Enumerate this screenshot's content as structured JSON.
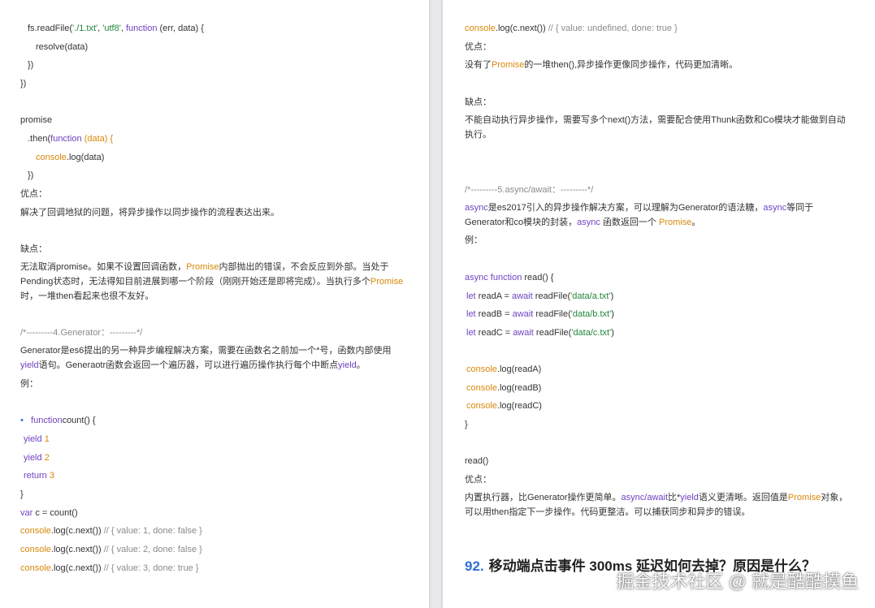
{
  "left": {
    "code_top": {
      "l1_call": "fs.readFile(",
      "l1_s1": "'./1.txt'",
      "l1_c1": ", ",
      "l1_s2": "'utf8'",
      "l1_c2": ", ",
      "l1_fn": "function",
      "l1_args": " (err, data) {",
      "l2": "resolve(data)",
      "l3": "})",
      "l4": "})"
    },
    "promise_code": {
      "l1": "promise",
      "l2_a": ".then(",
      "l2_fn": "function",
      "l2_b": " (data) {",
      "l3_obj": "console",
      "l3_b": ".log(data)",
      "l4": "})"
    },
    "pros_label": "优点：",
    "pros_text": "解决了回调地狱的问题，将异步操作以同步操作的流程表达出来。",
    "cons_label": "缺点：",
    "cons_text_1": "无法取消promise。如果不设置回调函数，",
    "cons_promise_1": "Promise",
    "cons_text_2": "内部抛出的错误，不会反应到外部。当处于Pending状态时，无法得知目前进展到哪一个阶段（刚刚开始还是即将完成）。当执行多个",
    "cons_promise_2": "Promise",
    "cons_text_3": "时，一堆then看起来也很不友好。",
    "gen_comment": "/*---------4.Generator：---------*/",
    "gen_desc_1": "Generator是es6提出的另一种异步编程解决方案，需要在函数名之前加一个*号，函数内部使用",
    "gen_yield_1": "yield",
    "gen_desc_2": "语句。Generaotr函数会返回一个遍历器，可以进行遍历操作执行每个中断点",
    "gen_yield_2": "yield",
    "gen_desc_3": "。",
    "example_label": "例：",
    "gen_code": {
      "bullet": "•",
      "l1_fn": "function",
      "l1_b": "count() {",
      "l2_kw": "yield",
      "l2_n": "1",
      "l3_kw": "yield",
      "l3_n": "2",
      "l4_kw": "return",
      "l4_n": "3",
      "l5": "}",
      "l6_kw": "var",
      "l6_b": " c = count()",
      "l7_obj": "console",
      "l7_b": ".log(c.next())",
      "l7_c": " // { value: 1, done: false }",
      "l8_obj": "console",
      "l8_b": ".log(c.next())",
      "l8_c": " // { value: 2, done: false }",
      "l9_obj": "console",
      "l9_b": ".log(c.next())",
      "l9_c": " // { value: 3, done: true }"
    }
  },
  "right": {
    "top_line": {
      "obj": "console",
      "b": ".log(c.next())",
      "c": " // { value: undefined, done: true }"
    },
    "pros_label": "优点：",
    "pros_text_1": "没有了",
    "pros_promise": "Promise",
    "pros_text_2": "的一堆then(),异步操作更像同步操作，代码更加清晰。",
    "cons_label": "缺点：",
    "cons_text": "不能自动执行异步操作，需要写多个next()方法，需要配合使用Thunk函数和Co模块才能做到自动执行。",
    "async_comment": "/*---------5.async/await：---------*/",
    "async_desc": {
      "kw1": "async",
      "t1": "是es2017引入的异步操作解决方案，可以理解为Generator的语法糖，",
      "kw2": "async",
      "t2": "等同于Generator和co模块的封装，",
      "kw3": "async",
      "t3": " 函数返回一个 ",
      "promise": "Promise",
      "t4": "。"
    },
    "example_label": "例：",
    "async_code": {
      "l1_kw": "async function",
      "l1_b": " read() {",
      "la_kw": "let",
      "la_b": " readA = ",
      "la_aw": "await",
      "la_c": " readFile(",
      "la_s": "'data/a.txt'",
      "la_e": ")",
      "lb_kw": "let",
      "lb_b": " readB = ",
      "lb_aw": "await",
      "lb_c": " readFile(",
      "lb_s": "'data/b.txt'",
      "lb_e": ")",
      "lc_kw": "let",
      "lc_b": " readC = ",
      "lc_aw": "await",
      "lc_c": " readFile(",
      "lc_s": "'data/c.txt'",
      "lc_e": ")",
      "p1_obj": "console",
      "p1_b": ".log(readA)",
      "p2_obj": "console",
      "p2_b": ".log(readB)",
      "p3_obj": "console",
      "p3_b": ".log(readC)",
      "close": "}",
      "call": "read()"
    },
    "pros2_label": "优点：",
    "pros2": {
      "t1": "内置执行器，比Generator操作更简单。",
      "kw": "async/await",
      "t2": "比*",
      "yield": "yield",
      "t3": "语义更清晰。返回值是",
      "promise": "Promise",
      "t4": "对象，可以用then指定下一步操作。代码更整洁。可以捕获同步和异步的错误。"
    },
    "heading_num": "92.",
    "heading_text": "移动端点击事件 300ms 延迟如何去掉？原因是什么？"
  },
  "watermark": "掘金技术社区 @ 就是酷酷摸鱼",
  "colors": {
    "keyword": "#6f42c1",
    "string": "#22863a",
    "object": "#d9880b",
    "comment": "#8a8a8a",
    "accent": "#2f6fd6"
  }
}
